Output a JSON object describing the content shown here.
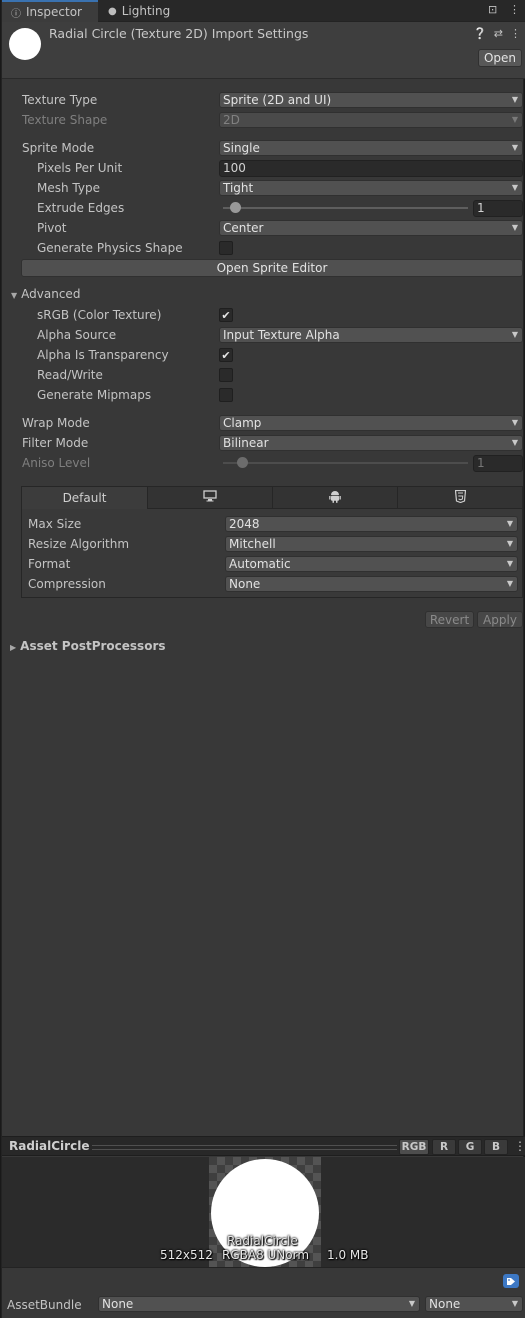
{
  "tabs": [
    {
      "label": "Inspector",
      "icon": "info-icon"
    },
    {
      "label": "Lighting",
      "icon": "lightbulb-icon"
    }
  ],
  "header": {
    "title": "Radial Circle (Texture 2D) Import Settings",
    "open_label": "Open"
  },
  "texture": {
    "type_label": "Texture Type",
    "type_value": "Sprite (2D and UI)",
    "shape_label": "Texture Shape",
    "shape_value": "2D"
  },
  "sprite": {
    "mode_label": "Sprite Mode",
    "mode_value": "Single",
    "ppu_label": "Pixels Per Unit",
    "ppu_value": "100",
    "mesh_label": "Mesh Type",
    "mesh_value": "Tight",
    "extrude_label": "Extrude Edges",
    "extrude_value": "1",
    "extrude_fraction": 0.03,
    "pivot_label": "Pivot",
    "pivot_value": "Center",
    "physics_label": "Generate Physics Shape",
    "physics_checked": false,
    "editor_button": "Open Sprite Editor"
  },
  "advanced": {
    "label": "Advanced",
    "srgb_label": "sRGB (Color Texture)",
    "srgb_checked": true,
    "alpha_source_label": "Alpha Source",
    "alpha_source_value": "Input Texture Alpha",
    "alpha_transparency_label": "Alpha Is Transparency",
    "alpha_transparency_checked": true,
    "readwrite_label": "Read/Write",
    "readwrite_checked": false,
    "mipmaps_label": "Generate Mipmaps",
    "mipmaps_checked": false
  },
  "sampling": {
    "wrap_label": "Wrap Mode",
    "wrap_value": "Clamp",
    "filter_label": "Filter Mode",
    "filter_value": "Bilinear",
    "aniso_label": "Aniso Level",
    "aniso_value": "1",
    "aniso_fraction": 0.06
  },
  "platform": {
    "default_tab": "Default",
    "tab_icons": [
      "monitor-icon",
      "android-icon",
      "html5-icon"
    ],
    "max_size_label": "Max Size",
    "max_size_value": "2048",
    "resize_label": "Resize Algorithm",
    "resize_value": "Mitchell",
    "format_label": "Format",
    "format_value": "Automatic",
    "compression_label": "Compression",
    "compression_value": "None"
  },
  "actions": {
    "revert": "Revert",
    "apply": "Apply"
  },
  "postprocessors_label": "Asset PostProcessors",
  "preview": {
    "name": "RadialCircle",
    "channels": [
      "RGB",
      "R",
      "G",
      "B"
    ],
    "active_channel": "RGB",
    "overlay_name": "RadialCircle",
    "dimensions": "512x512",
    "format": "RGBA8 UNorm",
    "size": "1.0 MB"
  },
  "assetbundle": {
    "label": "AssetBundle",
    "name_value": "None",
    "variant_value": "None"
  },
  "colors": {
    "panel": "#383838",
    "accent_tab": "#3a72b0",
    "field_dark": "#2a2a2a",
    "dropdown": "#515151"
  }
}
